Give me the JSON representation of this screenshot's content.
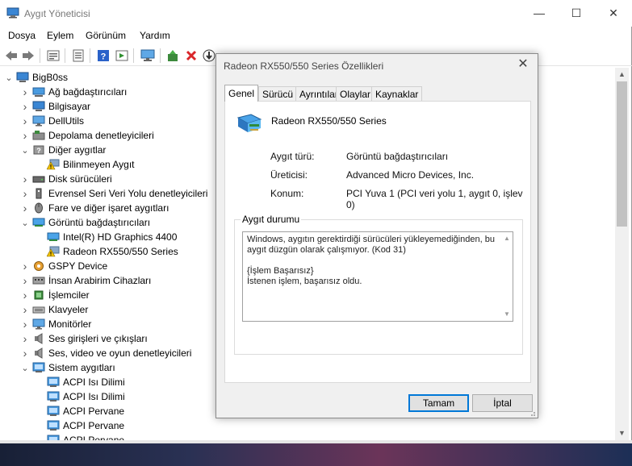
{
  "window": {
    "title": "Aygıt Yöneticisi",
    "controls": {
      "minimize": "—",
      "maximize": "☐",
      "close": "✕"
    }
  },
  "menu": [
    "Dosya",
    "Eylem",
    "Görünüm",
    "Yardım"
  ],
  "toolbar": [
    "back-icon",
    "forward-icon",
    "properties-icon",
    "device-list-icon",
    "help-icon",
    "view-icon",
    "monitor-icon",
    "update-driver-icon",
    "uninstall-icon",
    "download-icon"
  ],
  "tree": {
    "root": "BigB0ss",
    "items": [
      {
        "label": "Ağ bağdaştırıcıları",
        "level": 1,
        "state": "collapsed",
        "icon": "network-icon"
      },
      {
        "label": "Bilgisayar",
        "level": 1,
        "state": "collapsed",
        "icon": "computer-icon"
      },
      {
        "label": "DellUtils",
        "level": 1,
        "state": "collapsed",
        "icon": "monitor-icon"
      },
      {
        "label": "Depolama denetleyicileri",
        "level": 1,
        "state": "collapsed",
        "icon": "storage-icon"
      },
      {
        "label": "Diğer aygıtlar",
        "level": 1,
        "state": "expanded",
        "icon": "unknown-device-icon"
      },
      {
        "label": "Bilinmeyen Aygıt",
        "level": 2,
        "state": "none",
        "icon": "warning-device-icon"
      },
      {
        "label": "Disk sürücüleri",
        "level": 1,
        "state": "collapsed",
        "icon": "disk-icon"
      },
      {
        "label": "Evrensel Seri Veri Yolu denetleyicileri",
        "level": 1,
        "state": "collapsed",
        "icon": "usb-icon"
      },
      {
        "label": "Fare ve diğer işaret aygıtları",
        "level": 1,
        "state": "collapsed",
        "icon": "mouse-icon"
      },
      {
        "label": "Görüntü bağdaştırıcıları",
        "level": 1,
        "state": "expanded",
        "icon": "display-adapter-icon"
      },
      {
        "label": "Intel(R) HD Graphics 4400",
        "level": 2,
        "state": "none",
        "icon": "display-adapter-icon"
      },
      {
        "label": "Radeon RX550/550 Series",
        "level": 2,
        "state": "none",
        "icon": "warning-device-icon"
      },
      {
        "label": "GSPY Device",
        "level": 1,
        "state": "collapsed",
        "icon": "gear-device-icon"
      },
      {
        "label": "İnsan Arabirim Cihazları",
        "level": 1,
        "state": "collapsed",
        "icon": "hid-icon"
      },
      {
        "label": "İşlemciler",
        "level": 1,
        "state": "collapsed",
        "icon": "processor-icon"
      },
      {
        "label": "Klavyeler",
        "level": 1,
        "state": "collapsed",
        "icon": "keyboard-icon"
      },
      {
        "label": "Monitörler",
        "level": 1,
        "state": "collapsed",
        "icon": "monitor-icon"
      },
      {
        "label": "Ses girişleri ve çıkışları",
        "level": 1,
        "state": "collapsed",
        "icon": "speaker-icon"
      },
      {
        "label": "Ses, video ve oyun denetleyicileri",
        "level": 1,
        "state": "collapsed",
        "icon": "speaker-icon"
      },
      {
        "label": "Sistem aygıtları",
        "level": 1,
        "state": "expanded",
        "icon": "system-device-icon"
      },
      {
        "label": "ACPI Isı Dilimi",
        "level": 2,
        "state": "none",
        "icon": "system-device-icon"
      },
      {
        "label": "ACPI Isı Dilimi",
        "level": 2,
        "state": "none",
        "icon": "system-device-icon"
      },
      {
        "label": "ACPI Pervane",
        "level": 2,
        "state": "none",
        "icon": "system-device-icon"
      },
      {
        "label": "ACPI Pervane",
        "level": 2,
        "state": "none",
        "icon": "system-device-icon"
      },
      {
        "label": "ACPI Pervane",
        "level": 2,
        "state": "none",
        "icon": "system-device-icon"
      }
    ]
  },
  "dialog": {
    "title": "Radeon RX550/550 Series Özellikleri",
    "close": "✕",
    "tabs": [
      "Genel",
      "Sürücü",
      "Ayrıntılar",
      "Olaylar",
      "Kaynaklar"
    ],
    "active_tab": "Genel",
    "device_name": "Radeon RX550/550 Series",
    "properties": [
      {
        "label": "Aygıt türü:",
        "value": "Görüntü bağdaştırıcıları"
      },
      {
        "label": "Üreticisi:",
        "value": "Advanced Micro Devices, Inc."
      },
      {
        "label": "Konum:",
        "value": "PCI Yuva 1 (PCI veri yolu 1, aygıt 0, işlev 0)"
      }
    ],
    "status_group": "Aygıt durumu",
    "status_text": "Windows, aygıtın gerektirdiği sürücüleri yükleyemediğinden, bu aygıt düzgün olarak çalışmıyor. (Kod 31)\n\n{İşlem Başarısız}\nİstenen işlem, başarısız oldu.",
    "ok_label": "Tamam",
    "cancel_label": "İptal"
  },
  "colors": {
    "accent": "#0078d7",
    "warning": "#f2c200",
    "error": "#d9262a"
  }
}
